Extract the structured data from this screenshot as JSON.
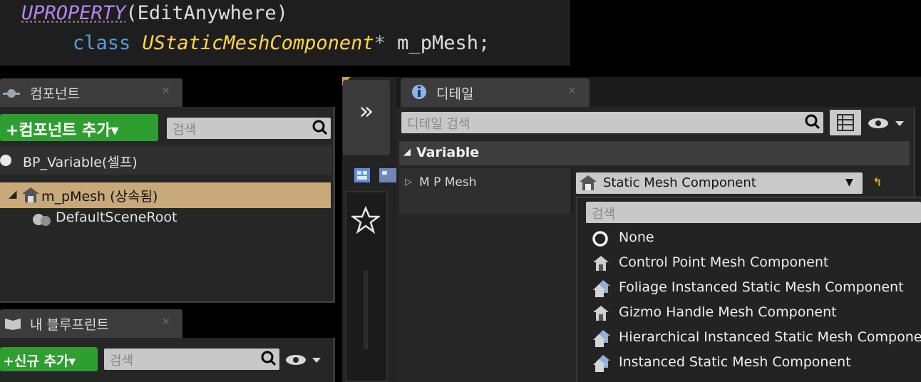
{
  "code": {
    "line1_macro": "UPROPERTY",
    "line1_args": "(EditAnywhere)",
    "line2_keyword": "class",
    "line2_type": "UStaticMeshComponent",
    "line2_ptr": "*",
    "line2_var": " m_pMesh;"
  },
  "components_panel": {
    "tab_label": "컴포넌트",
    "close": "×",
    "add_button": "+컴포넌트 추가▾",
    "search_placeholder": "검색",
    "tree": [
      {
        "label": "BP_Variable(셀프)"
      },
      {
        "label": "m_pMesh (상속됨)",
        "selected": true
      },
      {
        "label": "DefaultSceneRoot"
      }
    ]
  },
  "blueprint_panel": {
    "tab_label": "내 블루프린트",
    "close": "×",
    "add_button": "+신규 추가▾",
    "search_placeholder": "검색"
  },
  "middle_toolbar": {
    "expand": "»"
  },
  "details_panel": {
    "tab_label": "디테일",
    "close": "×",
    "search_placeholder": "디테일 검색",
    "category": "Variable",
    "property_name": "M P Mesh",
    "dropdown_value": "Static Mesh Component",
    "dropdown_search_placeholder": "검색",
    "options": [
      {
        "label": "None",
        "icon": "none-circle-icon"
      },
      {
        "label": "Control Point Mesh Component",
        "icon": "mesh-component-icon"
      },
      {
        "label": "Foliage Instanced Static Mesh Component",
        "icon": "instanced-mesh-icon"
      },
      {
        "label": "Gizmo Handle Mesh Component",
        "icon": "mesh-component-icon"
      },
      {
        "label": "Hierarchical Instanced Static Mesh Component",
        "icon": "instanced-mesh-icon"
      },
      {
        "label": "Instanced Static Mesh Component",
        "icon": "instanced-mesh-icon"
      }
    ]
  },
  "colors": {
    "accent_green": "#2f9e31",
    "selected_row": "#c9a97a",
    "panel_bg": "#262626",
    "reset_arrow": "#e0b010"
  }
}
